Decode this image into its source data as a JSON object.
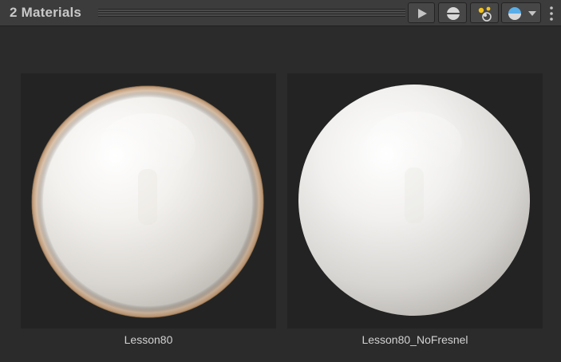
{
  "header": {
    "title": "2 Materials",
    "play_icon": "play-icon",
    "sphere_icon": "sphere-preview-icon",
    "lights_icon": "lights-icon",
    "skybox_icon": "skybox-icon",
    "menu_icon": "kebab-menu-icon"
  },
  "materials": [
    {
      "name": "Lesson80"
    },
    {
      "name": "Lesson80_NoFresnel"
    }
  ],
  "colors": {
    "panel_bg": "#2b2b2b",
    "header_bg": "#3c3c3c",
    "preview_bg": "#232323",
    "fresnel_rim": "#c8a07a"
  }
}
